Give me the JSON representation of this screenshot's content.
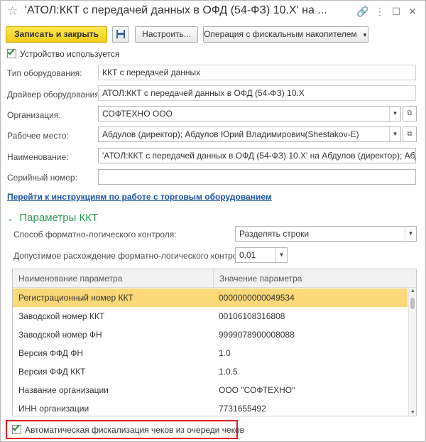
{
  "window": {
    "title": "'АТОЛ:ККТ с передачей данных в ОФД (54-ФЗ) 10.Х' на ..."
  },
  "toolbar": {
    "save_close": "Записать и закрыть",
    "configure": "Настроить...",
    "fiscal_ops": "Операция с фискальным накопителем"
  },
  "device_in_use": {
    "label": "Устройство используется",
    "checked": true
  },
  "form": {
    "equipment_type": {
      "label": "Тип оборудования:",
      "value": "ККТ с передачей данных"
    },
    "driver": {
      "label": "Драйвер оборудования:",
      "value": "АТОЛ:ККТ с передачей данных в ОФД (54-ФЗ) 10.Х"
    },
    "organization": {
      "label": "Организация:",
      "value": "СОФТЕХНО ООО"
    },
    "workplace": {
      "label": "Рабочее место:",
      "value": "Абдулов (директор); Абдулов Юрий Владимирович(Shestakov-E)"
    },
    "name": {
      "label": "Наименование:",
      "value": "'АТОЛ:ККТ с передачей данных в ОФД (54-ФЗ) 10.Х' на Абдулов (директор); Абдулов"
    },
    "serial": {
      "label": "Серийный номер:",
      "value": ""
    }
  },
  "instructions_link": "Перейти к инструкциям по работе с торговым оборудованием",
  "kkt_params": {
    "title": "Параметры ККТ",
    "flc_method": {
      "label": "Способ форматно-логического контроля:",
      "value": "Разделять строки"
    },
    "flc_tolerance": {
      "label": "Допустимое расхождение форматно-логического контроля:",
      "value": "0,01"
    }
  },
  "table": {
    "columns": [
      "Наименование параметра",
      "Значение параметра"
    ],
    "rows": [
      {
        "name": "Регистрационный номер ККТ",
        "value": "0000000000049534"
      },
      {
        "name": "Заводской номер ККТ",
        "value": "00106108316808"
      },
      {
        "name": "Заводской номер ФН",
        "value": "9999078900008088"
      },
      {
        "name": "Версия ФФД ФН",
        "value": "1.0"
      },
      {
        "name": "Версия ФФД ККТ",
        "value": "1.0.5"
      },
      {
        "name": "Название организации",
        "value": "ООО \"СОФТЕХНО\""
      },
      {
        "name": "ИНН организации",
        "value": "7731655492"
      }
    ],
    "selected_row": 0
  },
  "auto_fiscal": {
    "label": "Автоматическая фискализация чеков из очереди чеков",
    "checked": true
  },
  "colors": {
    "primary": "#f4cd19",
    "selected_row": "#fbd878",
    "link": "#1b57a8",
    "section": "#2a9b58",
    "highlight": "#e21a1a"
  }
}
